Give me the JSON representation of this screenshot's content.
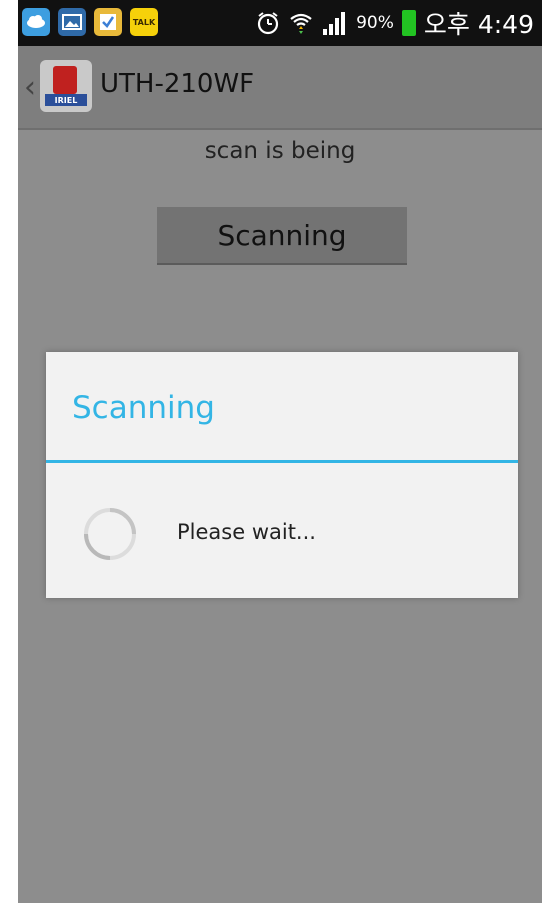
{
  "status_bar": {
    "icons": [
      "cloud-notification-icon",
      "gallery-icon",
      "memo-icon",
      "kakaotalk-icon"
    ],
    "talk_label": "TALK",
    "battery_percent": "90%",
    "time": "오후 4:49",
    "battery_color": "#22c322"
  },
  "action_bar": {
    "back_symbol": "‹",
    "app_brand": "IRIEL",
    "title": "UTH-210WF"
  },
  "content": {
    "status": "scan is being",
    "button_label": "Scanning"
  },
  "dialog": {
    "title": "Scanning",
    "message": "Please wait...",
    "accent_color": "#33b5e5"
  }
}
